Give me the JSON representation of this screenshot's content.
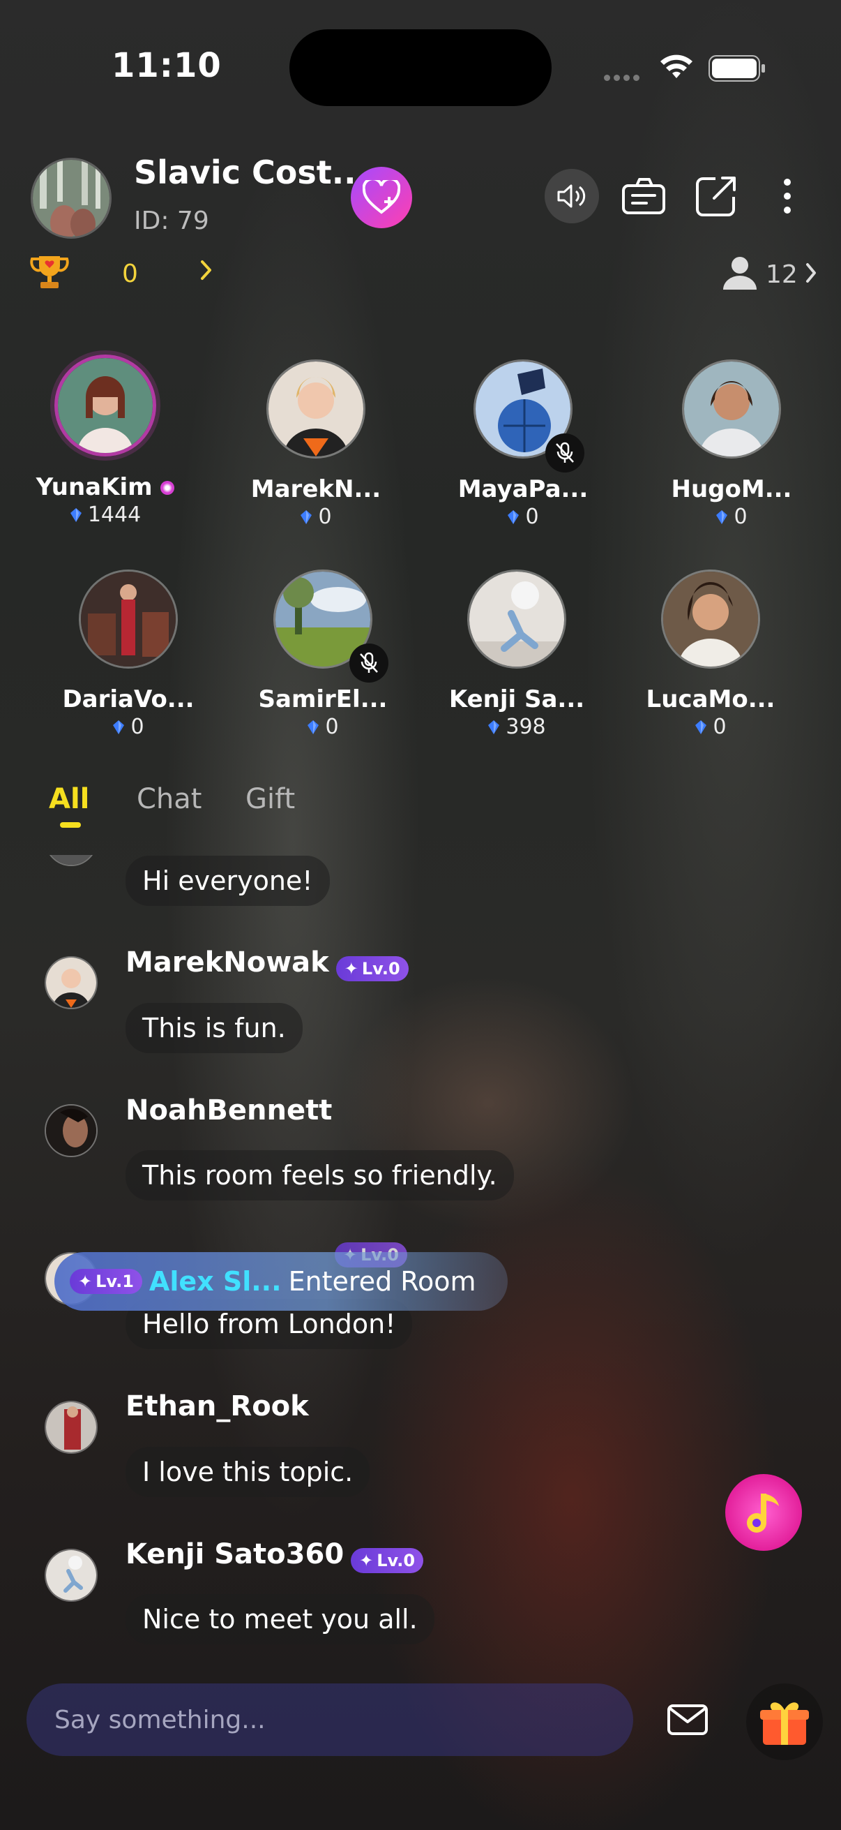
{
  "status_bar": {
    "time": "11:10"
  },
  "room": {
    "title": "Slavic Cost...",
    "id_label": "ID: 79",
    "trophy_count": "0",
    "viewer_count": "12"
  },
  "seats": [
    {
      "name": "YunaKim",
      "score": "1444"
    },
    {
      "name": "MarekN...",
      "score": "0"
    },
    {
      "name": "MayaPa...",
      "score": "0"
    },
    {
      "name": "HugoM...",
      "score": "0"
    },
    {
      "name": "DariaVo...",
      "score": "0"
    },
    {
      "name": "SamirEl...",
      "score": "0"
    },
    {
      "name": "Kenji Sa...",
      "score": "398"
    },
    {
      "name": "LucaMo...",
      "score": "0"
    }
  ],
  "tabs": {
    "all": "All",
    "chat": "Chat",
    "gift": "Gift"
  },
  "messages": [
    {
      "text": "Hi everyone!"
    },
    {
      "name": "MarekNowak",
      "level": "Lv.0",
      "text": "This is fun."
    },
    {
      "name": "NoahBennett",
      "text": "This room feels so friendly."
    },
    {
      "level": "Lv.0",
      "text": "Hello from London!"
    },
    {
      "name": "Ethan_Rook",
      "text": "I love this topic."
    },
    {
      "name": "Kenji Sato360",
      "level": "Lv.0",
      "text": "Nice to meet you all."
    }
  ],
  "entry_banner": {
    "level": "Lv.1",
    "user": "Alex Sl...",
    "text": "Entered Room"
  },
  "input": {
    "placeholder": "Say something..."
  },
  "colors": {
    "accent_yellow": "#f6df1f",
    "badge_purple": "#7a44dd",
    "entry_cyan": "#41e0ff",
    "fab_pink": "#e3209b"
  }
}
